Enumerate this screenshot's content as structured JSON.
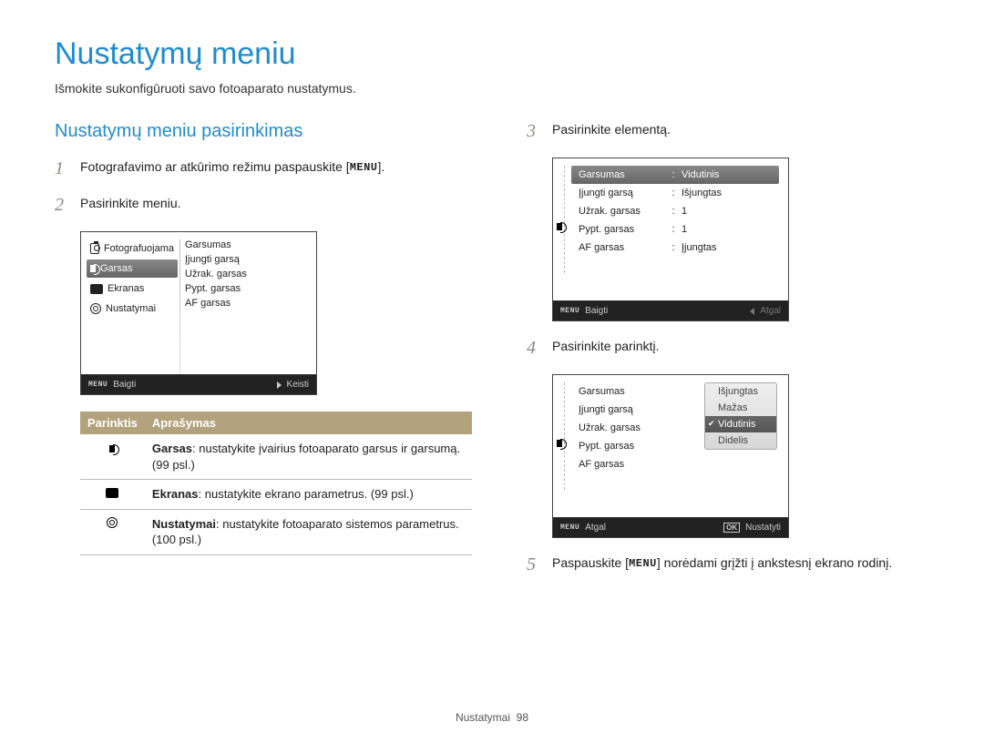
{
  "page": {
    "title": "Nustatymų meniu",
    "subtitle": "Išmokite sukonfigūruoti savo fotoaparato nustatymus.",
    "section_title": "Nustatymų meniu pasirinkimas",
    "menu_word": "MENU",
    "ok_word": "OK"
  },
  "steps": {
    "s1_num": "1",
    "s1_pre": "Fotografavimo ar atkūrimo režimu paspauskite [",
    "s1_post": "].",
    "s2_num": "2",
    "s2_text": "Pasirinkite meniu.",
    "s3_num": "3",
    "s3_text": "Pasirinkite elementą.",
    "s4_num": "4",
    "s4_text": "Pasirinkite parinktį.",
    "s5_num": "5",
    "s5_pre": "Paspauskite [",
    "s5_post": "] norėdami grįžti į ankstesnį ekrano rodinį."
  },
  "lcd1": {
    "left": {
      "camera": "Fotografuojama",
      "sound": "Garsas",
      "display": "Ekranas",
      "settings": "Nustatymai"
    },
    "right": {
      "r1": "Garsumas",
      "r2": "Įjungti garsą",
      "r3": "Užrak. garsas",
      "r4": "Pypt. garsas",
      "r5": "AF garsas"
    },
    "footer": {
      "left": "Baigti",
      "right": "Keisti"
    }
  },
  "opt_table": {
    "h1": "Parinktis",
    "h2": "Aprašymas",
    "r1b": "Garsas",
    "r1t": ": nustatykite įvairius fotoaparato garsus ir garsumą. (99 psl.)",
    "r2b": "Ekranas",
    "r2t": ": nustatykite ekrano parametrus. (99 psl.)",
    "r3b": "Nustatymai",
    "r3t": ": nustatykite fotoaparato sistemos parametrus. (100 psl.)"
  },
  "lcd2": {
    "rows": [
      {
        "k": "Garsumas",
        "v": "Vidutinis",
        "sel": true
      },
      {
        "k": "Įjungti garsą",
        "v": "Išjungtas"
      },
      {
        "k": "Užrak. garsas",
        "v": "1"
      },
      {
        "k": "Pypt. garsas",
        "v": "1"
      },
      {
        "k": "AF garsas",
        "v": "Įjungtas"
      }
    ],
    "footer": {
      "left": "Baigti",
      "right": "Atgal"
    }
  },
  "lcd3": {
    "rows": [
      {
        "k": "Garsumas"
      },
      {
        "k": "Įjungti garsą"
      },
      {
        "k": "Užrak. garsas"
      },
      {
        "k": "Pypt. garsas"
      },
      {
        "k": "AF garsas"
      }
    ],
    "popup": [
      "Išjungtas",
      "Mažas",
      "Vidutinis",
      "Didelis"
    ],
    "popup_selected": "Vidutinis",
    "footer": {
      "left": "Atgal",
      "right": "Nustatyti"
    }
  },
  "footer": {
    "section": "Nustatymai",
    "page": "98"
  }
}
